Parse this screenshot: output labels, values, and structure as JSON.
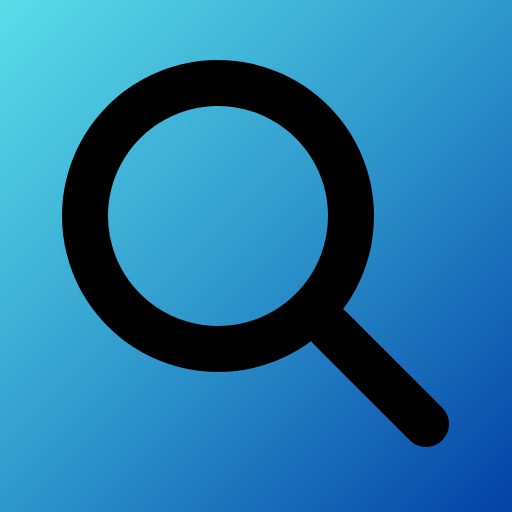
{
  "icon": {
    "name": "search-icon",
    "gradient_start": "#5ADDE8",
    "gradient_mid": "#2F98CC",
    "gradient_end": "#0342A6",
    "glyph_color": "#000000"
  }
}
